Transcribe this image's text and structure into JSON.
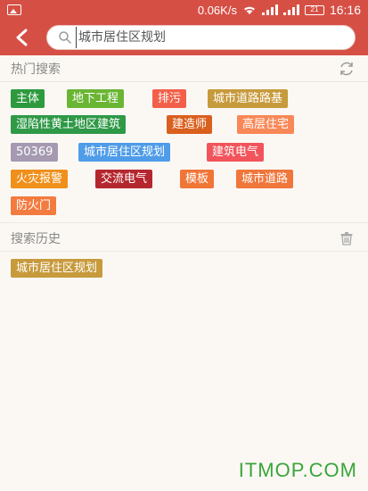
{
  "status_bar": {
    "speed": "0.06K/s",
    "battery": "21",
    "time": "16:16"
  },
  "search": {
    "value": "",
    "placeholder": "城市居住区规划"
  },
  "hot": {
    "title": "热门搜索",
    "tags": [
      {
        "label": "主体",
        "color": "#2e9a3e"
      },
      {
        "label": "地下工程",
        "color": "#6ab533"
      },
      {
        "label": "排污",
        "color": "#f3604a"
      },
      {
        "label": "城市道路路基",
        "color": "#c79a3c"
      },
      {
        "label": "湿陷性黄土地区建筑",
        "color": "#2f9947"
      },
      {
        "label": "建造师",
        "color": "#d9601f"
      },
      {
        "label": "高层住宅",
        "color": "#f88857"
      },
      {
        "label": "50369",
        "color": "#a59ab1"
      },
      {
        "label": "城市居住区规划",
        "color": "#4f9ce8"
      },
      {
        "label": "建筑电气",
        "color": "#f2545b"
      },
      {
        "label": "火灾报警",
        "color": "#f0901b"
      },
      {
        "label": "交流电气",
        "color": "#b5272e"
      },
      {
        "label": "模板",
        "color": "#f07537"
      },
      {
        "label": "城市道路",
        "color": "#f0763b"
      },
      {
        "label": "防火门",
        "color": "#f37b3f"
      }
    ]
  },
  "history": {
    "title": "搜索历史",
    "items": [
      {
        "label": "城市居住区规划",
        "color": "#c79a3c"
      }
    ]
  },
  "watermark": "ITMOP.COM"
}
